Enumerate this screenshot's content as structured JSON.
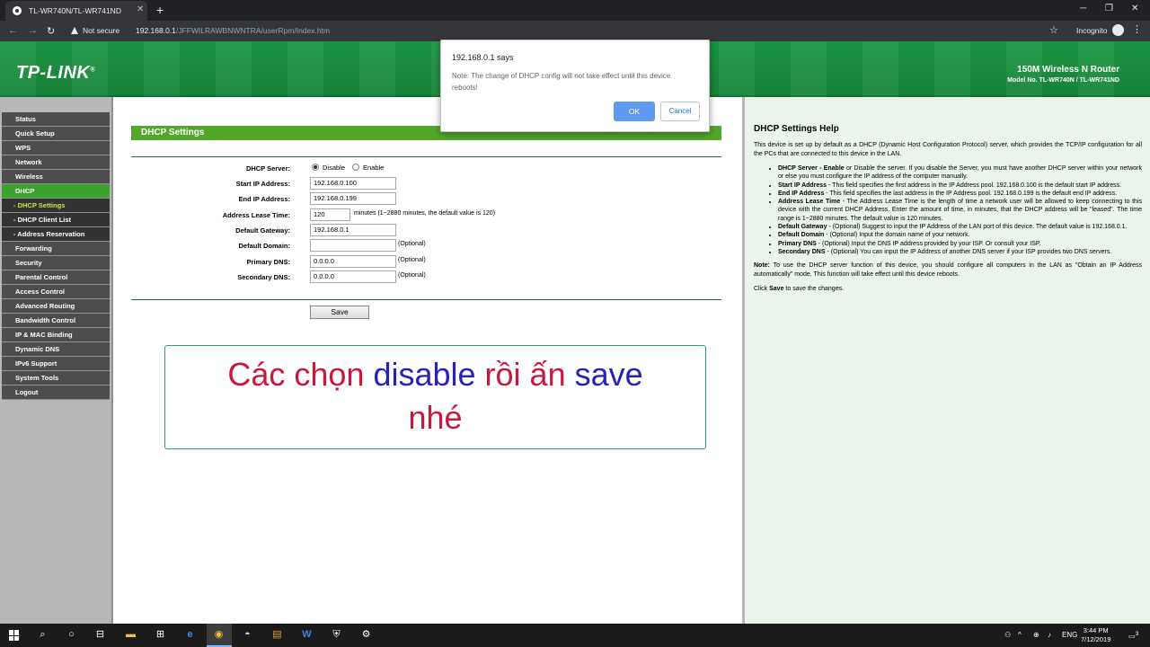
{
  "browser": {
    "tab_title": "TL-WR740N/TL-WR741ND",
    "tab_close": "✕",
    "new_tab": "+",
    "win_min": "─",
    "win_max": "❐",
    "win_close": "✕",
    "back": "←",
    "forward": "→",
    "reload": "↻",
    "security_label": "Not secure",
    "url_host": "192.168.0.1",
    "url_path": "/JFFWILRAWBNWNTRA/userRpm/Index.htm",
    "star": "☆",
    "incognito_label": "Incognito",
    "menu": "⋮"
  },
  "header": {
    "logo": "TP-LINK",
    "product": "150M Wireless N Router",
    "model": "Model No. TL-WR740N / TL-WR741ND"
  },
  "sidebar": {
    "items": [
      {
        "label": "Status"
      },
      {
        "label": "Quick Setup"
      },
      {
        "label": "WPS"
      },
      {
        "label": "Network"
      },
      {
        "label": "Wireless"
      },
      {
        "label": "DHCP"
      },
      {
        "label": "- DHCP Settings"
      },
      {
        "label": "- DHCP Client List"
      },
      {
        "label": "- Address Reservation"
      },
      {
        "label": "Forwarding"
      },
      {
        "label": "Security"
      },
      {
        "label": "Parental Control"
      },
      {
        "label": "Access Control"
      },
      {
        "label": "Advanced Routing"
      },
      {
        "label": "Bandwidth Control"
      },
      {
        "label": "IP & MAC Binding"
      },
      {
        "label": "Dynamic DNS"
      },
      {
        "label": "IPv6 Support"
      },
      {
        "label": "System Tools"
      },
      {
        "label": "Logout"
      }
    ]
  },
  "form": {
    "section_title": "DHCP Settings",
    "dhcp_server_label": "DHCP Server:",
    "disable_label": "Disable",
    "enable_label": "Enable",
    "start_ip_label": "Start IP Address:",
    "start_ip_value": "192.168.0.100",
    "end_ip_label": "End IP Address:",
    "end_ip_value": "192.168.0.199",
    "lease_label": "Address Lease Time:",
    "lease_value": "120",
    "lease_note": "minutes (1~2880 minutes, the default value is 120)",
    "gateway_label": "Default Gateway:",
    "gateway_value": "192.168.0.1",
    "domain_label": "Default Domain:",
    "domain_value": "",
    "primary_dns_label": "Primary DNS:",
    "primary_dns_value": "0.0.0.0",
    "secondary_dns_label": "Secondary DNS:",
    "secondary_dns_value": "0.0.0.0",
    "optional": "(Optional)",
    "save_label": "Save"
  },
  "overlay": {
    "w1": "Các chọn ",
    "w2": "disable",
    "w3": " rồi ấn ",
    "w4": "save",
    "w5": "nhé"
  },
  "help": {
    "title": "DHCP Settings Help",
    "intro": "This device is set up by default as a DHCP (Dynamic Host Configuration Protocol) server, which provides the TCP/IP configuration for all the PCs that are connected to this device in the LAN.",
    "items": [
      {
        "term": "DHCP Server - Enable",
        "text": " or Disable the server. If you disable the Server, you must have another DHCP server within your network or else you must configure the IP address of the computer manually."
      },
      {
        "term": "Start IP Address",
        "text": " - This field specifies the first address in the IP Address pool. 192.168.0.100 is the default start IP address."
      },
      {
        "term": "End IP Address",
        "text": " - This field specifies the last address in the IP Address pool. 192.168.0.199 is the default end IP address."
      },
      {
        "term": "Address Lease Time",
        "text": " - The Address Lease Time is the length of time a network user will be allowed to keep connecting to this device with the current DHCP Address. Enter the amount of time, in minutes, that the DHCP address will be \"leased\". The time range is 1~2880 minutes. The default value is 120 minutes."
      },
      {
        "term": "Default Gateway",
        "text": " - (Optional) Suggest to input the IP Address of the LAN port of this device. The default value is 192.168.0.1."
      },
      {
        "term": "Default Domain",
        "text": " - (Optional) Input the domain name of your network."
      },
      {
        "term": "Primary DNS",
        "text": " - (Optional) Input the DNS IP address provided by your ISP. Or consult your ISP."
      },
      {
        "term": "Secondary DNS",
        "text": " - (Optional) You can input the IP Address of another DNS server if your ISP provides two DNS servers."
      }
    ],
    "note_label": "Note:",
    "note_text": " To use the DHCP server function of this device, you should configure all computers in the LAN as \"Obtain an IP Address automatically\" mode. This function will take effect until this device reboots.",
    "click_prefix": "Click ",
    "click_save": "Save",
    "click_suffix": " to save the changes."
  },
  "dialog": {
    "title": "192.168.0.1 says",
    "message": "Note: The change of DHCP config will not take effect until this device reboots!",
    "ok_label": "OK",
    "cancel_label": "Cancel"
  },
  "taskbar": {
    "language": "ENG",
    "time": "3:44 PM",
    "date": "7/12/2019",
    "notification_count": "3"
  },
  "colors": {
    "header_green": "#1d8e3e",
    "section_green": "#52a72a",
    "menu_active": "#3ba22d",
    "overlay_red": "#c8183c",
    "overlay_blue": "#2424b8",
    "dialog_ok_blue": "#5e9bf0"
  }
}
